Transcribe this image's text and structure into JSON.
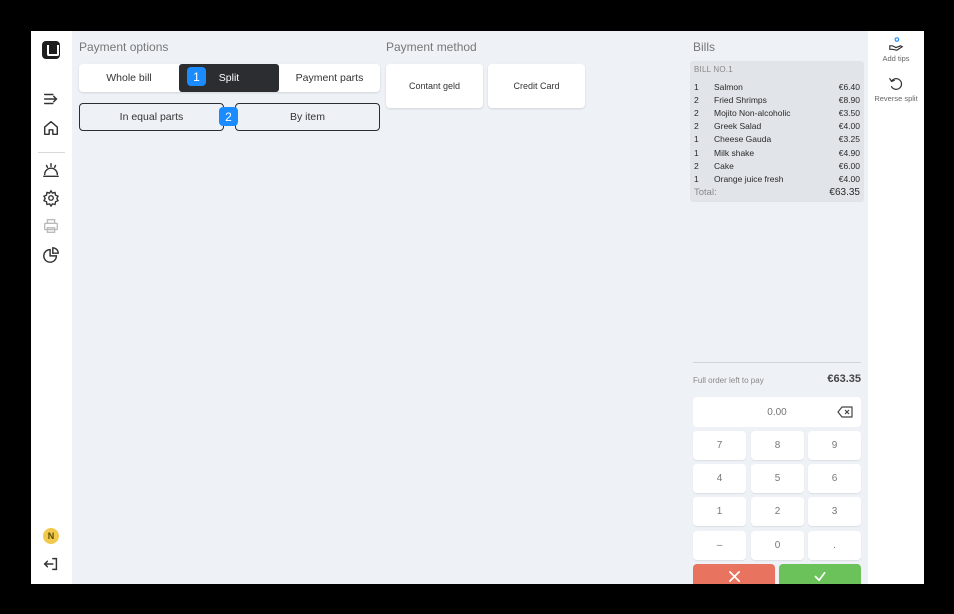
{
  "payment_options": {
    "title": "Payment options",
    "segments": [
      "Whole bill",
      "Split",
      "Payment parts"
    ],
    "active_segment": "Split",
    "sub_options": [
      "In equal parts",
      "By item"
    ]
  },
  "badges": {
    "first": "1",
    "second": "2"
  },
  "payment_method": {
    "title": "Payment method",
    "methods": [
      "Contant geld",
      "Credit Card"
    ]
  },
  "bills": {
    "title": "Bills",
    "bill_header": "BILL NO.1",
    "items": [
      {
        "qty": "1",
        "name": "Salmon",
        "price": "€6.40"
      },
      {
        "qty": "2",
        "name": "Fried Shrimps",
        "price": "€8.90"
      },
      {
        "qty": "2",
        "name": "Mojito Non-alcoholic",
        "price": "€3.50"
      },
      {
        "qty": "2",
        "name": "Greek Salad",
        "price": "€4.00"
      },
      {
        "qty": "1",
        "name": "Cheese Gauda",
        "price": "€3.25"
      },
      {
        "qty": "1",
        "name": "Milk shake",
        "price": "€4.90"
      },
      {
        "qty": "2",
        "name": "Cake",
        "price": "€6.00"
      },
      {
        "qty": "1",
        "name": "Orange juice fresh",
        "price": "€4.00"
      }
    ],
    "total_label": "Total:",
    "total_value": "€63.35"
  },
  "summary": {
    "left_label": "Full order left to pay",
    "left_amount": "€63.35"
  },
  "amount_input": {
    "value": "0.00"
  },
  "keypad": [
    "7",
    "8",
    "9",
    "4",
    "5",
    "6",
    "1",
    "2",
    "3",
    "–",
    "0",
    "."
  ],
  "actions": {
    "add_tips": "Add tips",
    "reverse_split": "Reverse split"
  },
  "user": {
    "initial": "N"
  },
  "colors": {
    "accent": "#1a8cff",
    "cancel": "#e8735f",
    "confirm": "#6cc25a",
    "dark": "#2b2d31"
  }
}
